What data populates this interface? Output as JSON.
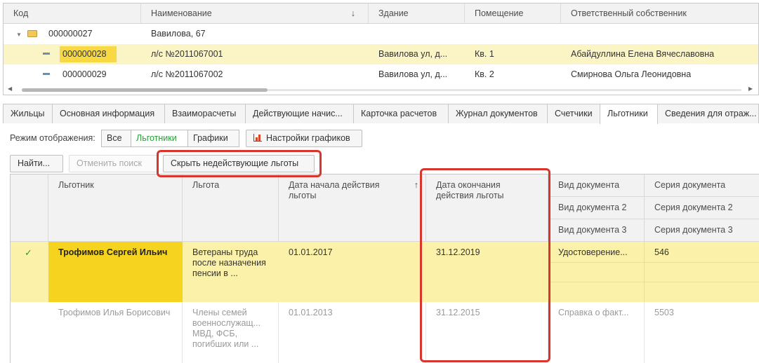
{
  "top_table": {
    "columns": {
      "code": "Код",
      "name": "Наименование",
      "sort_arrow": "↓",
      "building": "Здание",
      "room": "Помещение",
      "owner": "Ответственный собственник"
    },
    "rows": [
      {
        "code": "000000027",
        "name": "Вавилова, 67",
        "building": "",
        "room": "",
        "owner": ""
      },
      {
        "code": "000000028",
        "name": "л/с №2011067001",
        "building": "Вавилова ул, д...",
        "room": "Кв. 1",
        "owner": "Абайдуллина Елена Вячеславовна"
      },
      {
        "code": "000000029",
        "name": "л/с №2011067002",
        "building": "Вавилова ул, д...",
        "room": "Кв. 2",
        "owner": "Смирнова Ольга Леонидовна"
      }
    ]
  },
  "tabs": [
    "Жильцы",
    "Основная информация",
    "Взаиморасчеты",
    "Действующие начис...",
    "Карточка расчетов",
    "Журнал документов",
    "Счетчики",
    "Льготники",
    "Сведения для отраж..."
  ],
  "active_tab": "Льготники",
  "toolbar": {
    "mode_label": "Режим отображения:",
    "mode_all": "Все",
    "mode_beneficiaries": "Льготники",
    "mode_charts": "Графики",
    "chart_settings": "Настройки графиков",
    "find": "Найти...",
    "cancel_search": "Отменить поиск",
    "hide_inactive": "Скрыть недействующие льготы"
  },
  "grid": {
    "headers": {
      "beneficiary": "Льготник",
      "benefit": "Льгота",
      "start_date": "Дата начала действия льготы",
      "sort_arrow": "↑",
      "end_date": "Дата окончания действия льготы",
      "doc_type": "Вид документа",
      "doc_type2": "Вид документа 2",
      "doc_type3": "Вид документа 3",
      "doc_series": "Серия документа",
      "doc_series2": "Серия документа 2",
      "doc_series3": "Серия документа 3"
    },
    "rows": [
      {
        "active": true,
        "check": "✓",
        "beneficiary": "Трофимов Сергей Ильич",
        "benefit": "Ветераны труда после назначения пенсии в ...",
        "start": "01.01.2017",
        "end": "31.12.2019",
        "doc_type": "Удостоверение...",
        "doc_series": "546"
      },
      {
        "active": false,
        "check": "",
        "beneficiary": "Трофимов Илья Борисович",
        "benefit": "Члены семей военнослужащ... МВД, ФСБ, погибших или ...",
        "start": "01.01.2013",
        "end": "31.12.2015",
        "doc_type": "Справка о факт...",
        "doc_series": "5503"
      }
    ]
  },
  "colors": {
    "selected_row": "#fbf1a9",
    "selected_cell": "#f6d31f",
    "highlight_box": "#d8362c",
    "active_mode": "#2e9a3a"
  }
}
